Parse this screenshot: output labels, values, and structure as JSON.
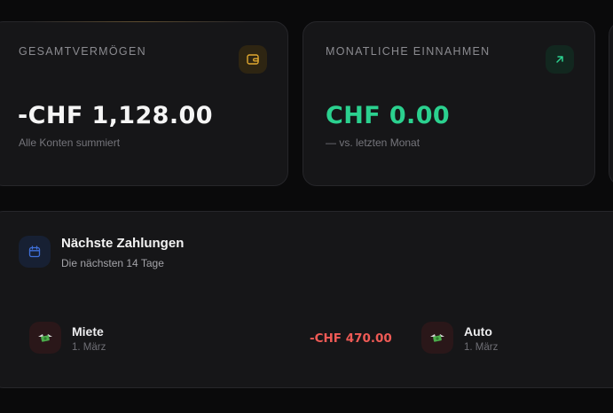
{
  "cards": {
    "assets": {
      "label": "GESAMTVERMÖGEN",
      "value": "-CHF 1,128.00",
      "subtitle": "Alle Konten summiert",
      "icon": "wallet-icon",
      "accent": "#e0a830"
    },
    "income": {
      "label": "MONATLICHE EINNAHMEN",
      "value": "CHF 0.00",
      "subtitle": "— vs. letzten Monat",
      "icon": "arrow-up-right-icon",
      "accent": "#2bd18f"
    }
  },
  "upcoming": {
    "title": "Nächste Zahlungen",
    "subtitle": "Die nächsten 14 Tage",
    "icon": "calendar-icon",
    "accent": "#3f6fd8",
    "items": [
      {
        "name": "Miete",
        "date": "1. März",
        "amount": "-CHF 470.00",
        "icon": "money-wings-icon"
      },
      {
        "name": "Auto",
        "date": "1. März",
        "icon": "money-wings-icon"
      }
    ]
  },
  "colors": {
    "background": "#0a0a0b",
    "card": "#161618",
    "negative": "#ee5a55",
    "positive": "#2bd18f"
  }
}
